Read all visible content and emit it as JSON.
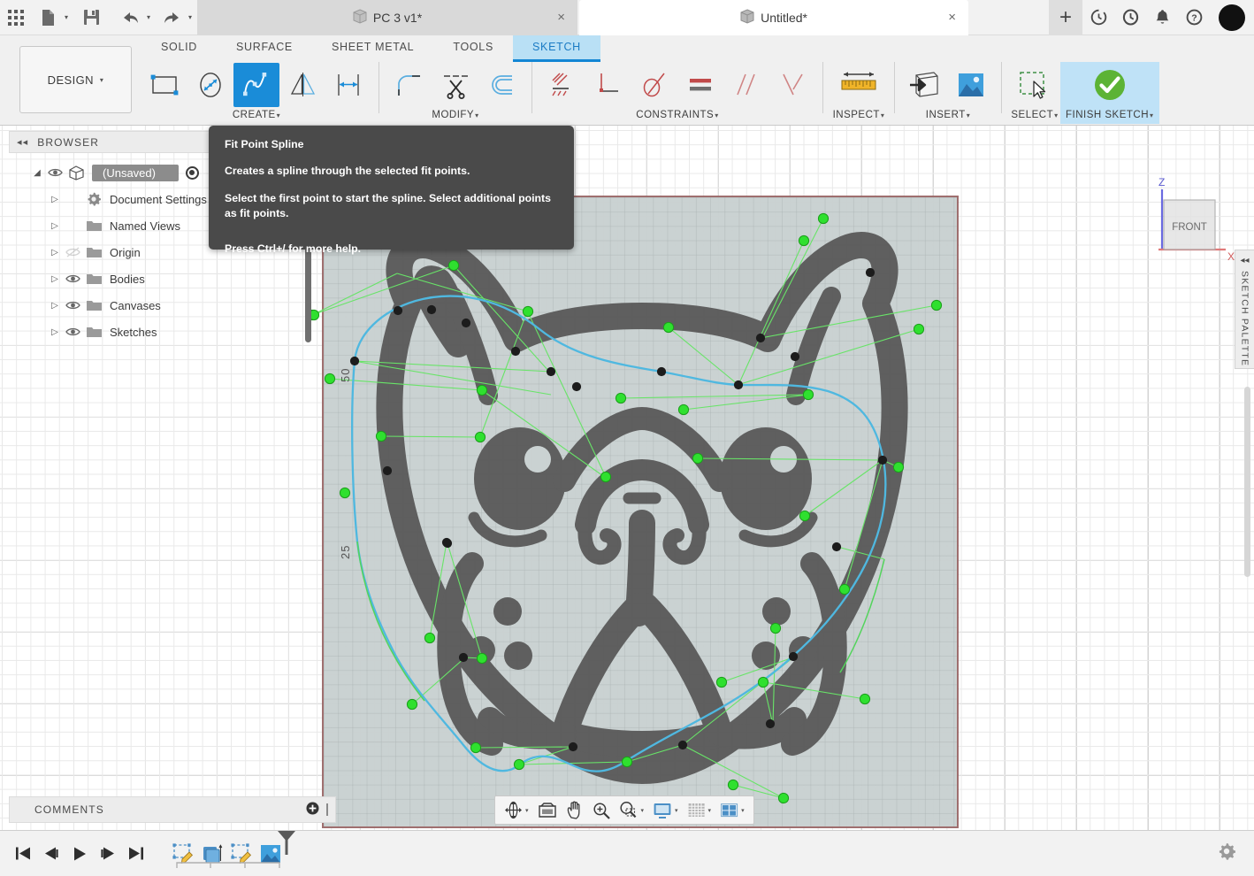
{
  "titlebar": {
    "grid_icon": "apps-grid-icon",
    "new_label": "new-document",
    "save_label": "save",
    "undo_label": "undo",
    "redo_label": "redo",
    "tabs": [
      {
        "title": "PC 3 v1*",
        "active": false,
        "close": "×"
      },
      {
        "title": "Untitled*",
        "active": true,
        "close": "×"
      }
    ],
    "new_tab": "+",
    "right_icons": [
      "job-status-icon",
      "recent-icon",
      "notifications-icon",
      "help-icon"
    ]
  },
  "ribbon": {
    "workspace": "DESIGN",
    "workspace_caret": "▾",
    "tabs": [
      {
        "label": "SOLID",
        "active": false
      },
      {
        "label": "SURFACE",
        "active": false
      },
      {
        "label": "SHEET METAL",
        "active": false
      },
      {
        "label": "TOOLS",
        "active": false
      },
      {
        "label": "SKETCH",
        "active": true
      }
    ],
    "groups": [
      {
        "label": "CREATE",
        "caret": "▾",
        "buttons": [
          {
            "name": "rectangle-tool",
            "selected": false
          },
          {
            "name": "ellipse-tool",
            "selected": false
          },
          {
            "name": "fit-point-spline-tool",
            "selected": true
          },
          {
            "name": "mirror-tool",
            "selected": false
          },
          {
            "name": "sketch-dimension-tool",
            "selected": false
          }
        ]
      },
      {
        "label": "MODIFY",
        "caret": "▾",
        "buttons": [
          {
            "name": "fillet-tool",
            "selected": false
          },
          {
            "name": "trim-tool",
            "selected": false
          },
          {
            "name": "offset-tool",
            "selected": false
          }
        ]
      },
      {
        "label": "CONSTRAINTS",
        "caret": "▾",
        "buttons": [
          {
            "name": "horizontal-vertical-constraint",
            "selected": false
          },
          {
            "name": "coincident-constraint",
            "selected": false
          },
          {
            "name": "tangent-constraint",
            "selected": false
          },
          {
            "name": "equal-constraint",
            "selected": false
          },
          {
            "name": "parallel-constraint",
            "selected": false
          },
          {
            "name": "perpendicular-constraint",
            "selected": false
          }
        ]
      },
      {
        "label": "INSPECT",
        "caret": "▾",
        "buttons": [
          {
            "name": "measure-tool",
            "selected": false
          }
        ]
      },
      {
        "label": "INSERT",
        "caret": "▾",
        "buttons": [
          {
            "name": "insert-derive-tool",
            "selected": false
          },
          {
            "name": "insert-canvas-tool",
            "selected": false
          }
        ]
      },
      {
        "label": "SELECT",
        "caret": "▾",
        "buttons": [
          {
            "name": "select-tool",
            "selected": false
          }
        ]
      },
      {
        "label": "FINISH SKETCH",
        "caret": "▾",
        "highlight": true,
        "buttons": [
          {
            "name": "finish-sketch-button",
            "selected": false
          }
        ]
      }
    ]
  },
  "browser": {
    "title": "BROWSER",
    "collapse_icon": "◂◂",
    "items": [
      {
        "label": "(Unsaved)",
        "indent": 0,
        "expander": "◢",
        "eye": true,
        "icon": "document-icon",
        "root": true,
        "radio": true
      },
      {
        "label": "Document Settings",
        "indent": 1,
        "expander": "▷",
        "eye": false,
        "icon": "gear-icon"
      },
      {
        "label": "Named Views",
        "indent": 1,
        "expander": "▷",
        "eye": false,
        "icon": "folder-icon"
      },
      {
        "label": "Origin",
        "indent": 1,
        "expander": "▷",
        "eye": true,
        "eye_off": true,
        "icon": "folder-icon"
      },
      {
        "label": "Bodies",
        "indent": 1,
        "expander": "▷",
        "eye": true,
        "icon": "folder-icon"
      },
      {
        "label": "Canvases",
        "indent": 1,
        "expander": "▷",
        "eye": true,
        "icon": "folder-icon"
      },
      {
        "label": "Sketches",
        "indent": 1,
        "expander": "▷",
        "eye": true,
        "icon": "folder-icon"
      }
    ]
  },
  "tooltip": {
    "title": "Fit Point Spline",
    "description": "Creates a spline through the selected fit points.",
    "instruction": "Select the first point to start the spline. Select additional points as fit points.",
    "help": "Press Ctrl+/ for more help."
  },
  "canvas": {
    "ruler_labels": [
      "50",
      "25"
    ],
    "viewcube_face": "FRONT",
    "axis_z": "Z",
    "axis_x": "X",
    "canvas_image_subject": "french-bulldog-face-silhouette",
    "colors": {
      "spline_curve": "#4fb8e0",
      "fit_point": "#1c1c1c",
      "handle_point": "#2fe02f",
      "handle_line": "#68e468",
      "canvas_bg": "#c9d1d1",
      "canvas_border": "#9c6b6b",
      "artwork": "#5a5a5a",
      "accent": "#1a8cd8",
      "finish_green": "#5cb335"
    }
  },
  "sketch_palette": {
    "label": "SKETCH PALETTE",
    "collapse_icon": "◂◂"
  },
  "view_toolbar": {
    "buttons": [
      {
        "name": "orbit-tool",
        "caret": "▾"
      },
      {
        "name": "look-at-tool",
        "caret": ""
      },
      {
        "name": "pan-tool",
        "caret": ""
      },
      {
        "name": "zoom-in-tool",
        "caret": ""
      },
      {
        "name": "zoom-window-tool",
        "caret": "▾"
      },
      {
        "name": "display-settings",
        "caret": "▾"
      },
      {
        "name": "grid-snaps",
        "caret": "▾"
      },
      {
        "name": "viewports",
        "caret": "▾"
      }
    ]
  },
  "comments": {
    "label": "COMMENTS",
    "add_icon": "⊕"
  },
  "bottombar": {
    "nav": [
      {
        "name": "timeline-go-to-beginning",
        "glyph": "⏮"
      },
      {
        "name": "timeline-step-back",
        "glyph": "⏴"
      },
      {
        "name": "timeline-play",
        "glyph": "▶"
      },
      {
        "name": "timeline-step-forward",
        "glyph": "⏵"
      },
      {
        "name": "timeline-go-to-end",
        "glyph": "⏭"
      }
    ],
    "timeline_features": [
      {
        "name": "timeline-sketch-1"
      },
      {
        "name": "timeline-extrude-1"
      },
      {
        "name": "timeline-sketch-2"
      },
      {
        "name": "timeline-canvas-1"
      }
    ],
    "settings_icon": "gear-icon"
  }
}
